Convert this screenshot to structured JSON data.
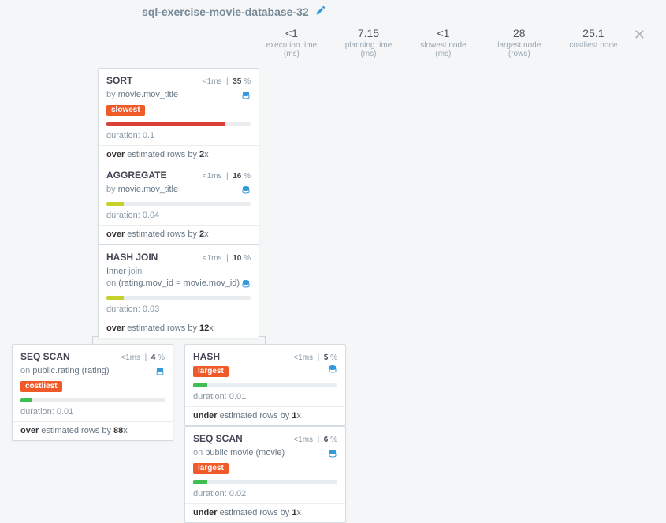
{
  "title": "sql-exercise-movie-database-32",
  "stats": {
    "execution_time": {
      "value": "<1",
      "label": "execution time (ms)"
    },
    "planning_time": {
      "value": "7.15",
      "label": "planning time (ms)"
    },
    "slowest_node": {
      "value": "<1",
      "label": "slowest node (ms)"
    },
    "largest_node": {
      "value": "28",
      "label": "largest node (rows)"
    },
    "costliest_node": {
      "value": "25.1",
      "label": "costliest node"
    }
  },
  "labels": {
    "duration_prefix": "duration: ",
    "by": "by ",
    "on": "on ",
    "join": " join",
    "under_x": "x",
    "over_x": "x"
  },
  "nodes": {
    "sort": {
      "op": "SORT",
      "time": "<1",
      "time_unit": "ms",
      "pct": "35",
      "pct_unit": " %",
      "by": "movie.mov_title",
      "tag": "slowest",
      "bar_width": "82%",
      "bar_class": "fill-red",
      "duration": "0.1",
      "est_dir": "over",
      "est_mid": " estimated rows by ",
      "est_factor": "2"
    },
    "agg": {
      "op": "AGGREGATE",
      "time": "<1",
      "time_unit": "ms",
      "pct": "16",
      "pct_unit": " %",
      "by": "movie.mov_title",
      "bar_width": "12%",
      "bar_class": "fill-lime",
      "duration": "0.04",
      "est_dir": "over",
      "est_mid": " estimated rows by ",
      "est_factor": "2"
    },
    "join": {
      "op": "HASH JOIN",
      "time": "<1",
      "time_unit": "ms",
      "pct": "10",
      "pct_unit": " %",
      "join_type": "Inner",
      "join_on_prefix": "on ",
      "join_on": "(rating.mov_id = movie.mov_id)",
      "bar_width": "12%",
      "bar_class": "fill-lime",
      "duration": "0.03",
      "est_dir": "over",
      "est_mid": " estimated rows by ",
      "est_factor": "12"
    },
    "seq1": {
      "op": "SEQ SCAN",
      "time": "<1",
      "time_unit": "ms",
      "pct": "4",
      "pct_unit": " %",
      "on": "public.rating (rating)",
      "tag": "costliest",
      "bar_width": "8%",
      "bar_class": "fill-green",
      "duration": "0.01",
      "est_dir": "over",
      "est_mid": " estimated rows by ",
      "est_factor": "88"
    },
    "hash": {
      "op": "HASH",
      "time": "<1",
      "time_unit": "ms",
      "pct": "5",
      "pct_unit": " %",
      "tag": "largest",
      "bar_width": "10%",
      "bar_class": "fill-green",
      "duration": "0.01",
      "est_dir": "under",
      "est_mid": " estimated rows by ",
      "est_factor": "1"
    },
    "seq2": {
      "op": "SEQ SCAN",
      "time": "<1",
      "time_unit": "ms",
      "pct": "6",
      "pct_unit": " %",
      "on": "public.movie (movie)",
      "tag": "largest",
      "bar_width": "10%",
      "bar_class": "fill-green",
      "duration": "0.02",
      "est_dir": "under",
      "est_mid": " estimated rows by ",
      "est_factor": "1"
    }
  }
}
